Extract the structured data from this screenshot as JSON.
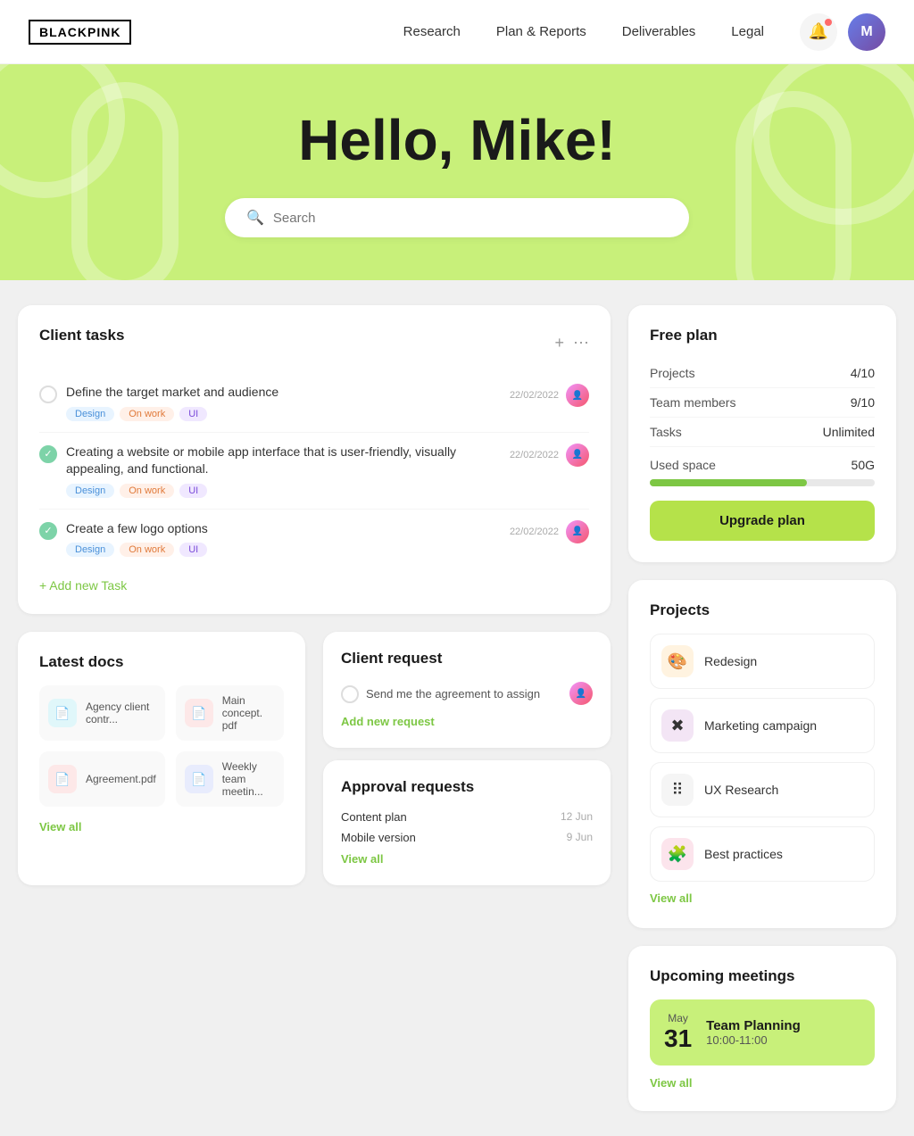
{
  "brand": "BLACKPINK",
  "nav": {
    "links": [
      "Research",
      "Plan & Reports",
      "Deliverables",
      "Legal"
    ]
  },
  "hero": {
    "greeting": "Hello, Mike!",
    "search_placeholder": "Search"
  },
  "client_tasks": {
    "title": "Client tasks",
    "tasks": [
      {
        "text": "Define the target market and audience",
        "done": false,
        "tags": [
          "Design",
          "On work",
          "UI"
        ],
        "date": "22/02/2022"
      },
      {
        "text": "Creating a website or mobile app interface that is user-friendly, visually appealing, and functional.",
        "done": true,
        "tags": [
          "Design",
          "On work",
          "UI"
        ],
        "date": "22/02/2022"
      },
      {
        "text": "Create a few logo options",
        "done": true,
        "tags": [
          "Design",
          "On work",
          "UI"
        ],
        "date": "22/02/2022"
      }
    ],
    "add_label": "+ Add new Task"
  },
  "latest_docs": {
    "title": "Latest docs",
    "docs": [
      {
        "name": "Agency client contr...",
        "color": "#4ac8d6"
      },
      {
        "name": "Main concept. pdf",
        "color": "#f07a7a"
      },
      {
        "name": "Agreement.pdf",
        "color": "#f07a7a"
      },
      {
        "name": "Weekly team meetin...",
        "color": "#7a9af0"
      }
    ],
    "view_all": "View all"
  },
  "client_request": {
    "title": "Client request",
    "text": "Send me the agreement to assign",
    "add_label": "Add new request"
  },
  "approval_requests": {
    "title": "Approval requests",
    "items": [
      {
        "name": "Content plan",
        "date": "12 Jun"
      },
      {
        "name": "Mobile version",
        "date": "9 Jun"
      }
    ],
    "view_all": "View all"
  },
  "free_plan": {
    "title": "Free plan",
    "rows": [
      {
        "label": "Projects",
        "value": "4/10"
      },
      {
        "label": "Team members",
        "value": "9/10"
      },
      {
        "label": "Tasks",
        "value": "Unlimited"
      }
    ],
    "used_space_label": "Used space",
    "used_space_value": "50G",
    "progress_pct": 70,
    "upgrade_label": "Upgrade plan"
  },
  "projects": {
    "title": "Projects",
    "items": [
      {
        "name": "Redesign",
        "emoji": "🎨",
        "color": "#f5a623"
      },
      {
        "name": "Marketing campaign",
        "emoji": "✖️",
        "color": "#8b5cf6"
      },
      {
        "name": "UX Research",
        "emoji": "⠿",
        "color": "#374151"
      },
      {
        "name": "Best practices",
        "emoji": "🧩",
        "color": "#ec4899"
      }
    ],
    "view_all": "View all"
  },
  "upcoming_meetings": {
    "title": "Upcoming meetings",
    "meeting": {
      "month": "May",
      "day": "31",
      "title": "Team Planning",
      "time": "10:00-11:00"
    },
    "view_all": "View all"
  }
}
